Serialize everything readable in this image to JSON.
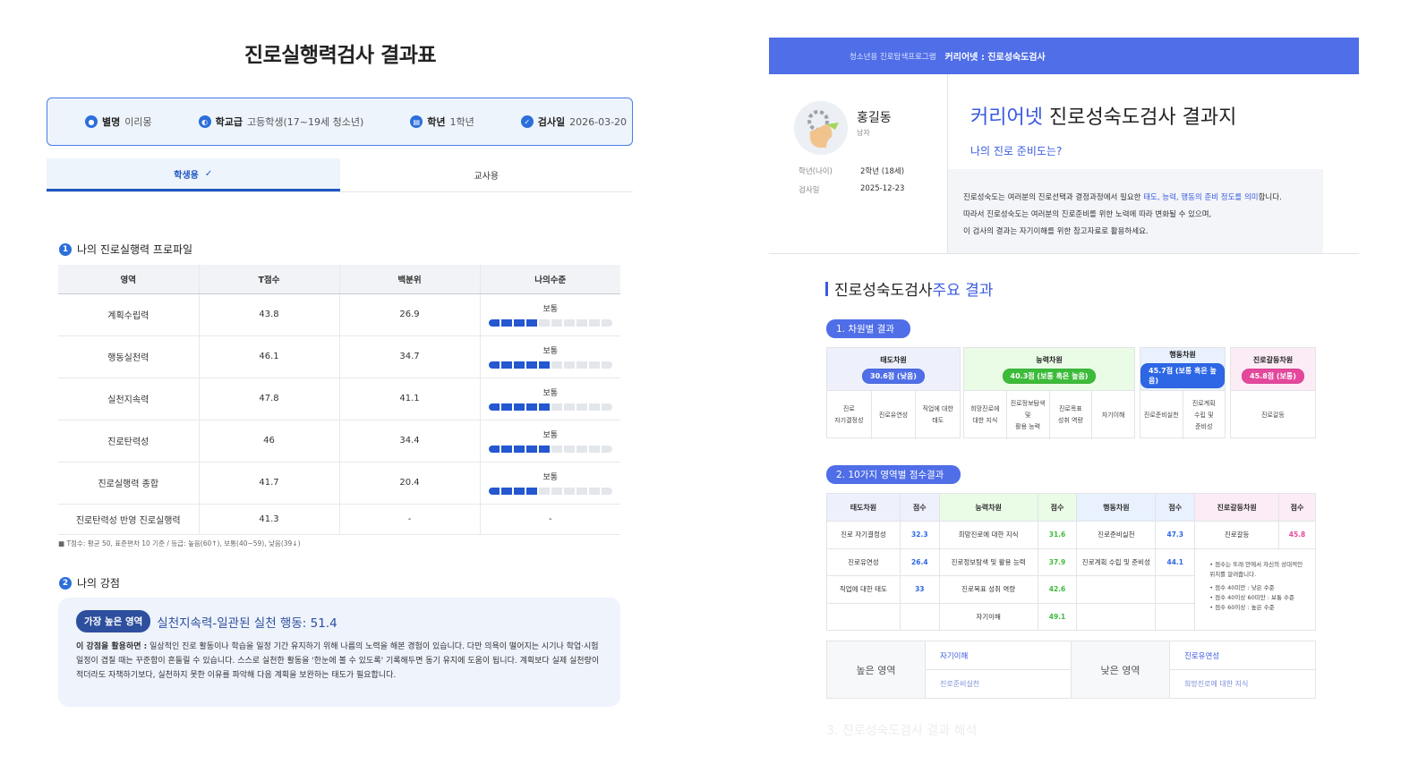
{
  "left": {
    "title": "진로실행력검사 결과표",
    "info": {
      "name_label": "별명",
      "name_value": "이리몽",
      "school_label": "학교급",
      "school_value": "고등학생(17~19세 청소년)",
      "grade_label": "학년",
      "grade_value": "1학년",
      "date_label": "검사일",
      "date_value": "2026-03-20"
    },
    "tabs": {
      "student": "학생용",
      "student_check": "✓",
      "teacher": "교사용"
    },
    "section1": {
      "num": "1",
      "title": "나의 진로실행력 프로파일"
    },
    "table": {
      "headers": [
        "영역",
        "T점수",
        "백분위",
        "나의수준"
      ],
      "rows": [
        {
          "area": "계획수립력",
          "t": "43.8",
          "pct": "26.9",
          "level": "보통",
          "filled": 4,
          "total": 10
        },
        {
          "area": "행동실천력",
          "t": "46.1",
          "pct": "34.7",
          "level": "보통",
          "filled": 5,
          "total": 10
        },
        {
          "area": "실천지속력",
          "t": "47.8",
          "pct": "41.1",
          "level": "보통",
          "filled": 5,
          "total": 10
        },
        {
          "area": "진로탄력성",
          "t": "46",
          "pct": "34.4",
          "level": "보통",
          "filled": 5,
          "total": 10
        },
        {
          "area": "진로실행력 종합",
          "t": "41.7",
          "pct": "20.4",
          "level": "보통",
          "filled": 4,
          "total": 10
        },
        {
          "area": "진로탄력성 반영 진로실행력",
          "t": "41.3",
          "pct": "-",
          "level": "-"
        }
      ]
    },
    "note": "■ T점수: 평균 50, 표준편차 10 기준 / 등급: 높음(60↑), 보통(40~59), 낮음(39↓)",
    "section2": {
      "num": "2",
      "title": "나의 강점"
    },
    "strength": {
      "badge": "가장 높은 영역",
      "title": "실천지속력-일관된 실천 행동: 51.4",
      "lead": "이 강점을 활용하면 :",
      "body": " 일상적인 진로 활동이나 학습을 일정 기간 유지하기 위해 나름의 노력을 해본 경험이 있습니다. 다만 의욕이 떨어지는 시기나 학업·시험 일정이 겹칠 때는 꾸준함이 흔들릴 수 있습니다. 스스로 실천한 활동을 '한눈에 볼 수 있도록' 기록해두면 동기 유지에 도움이 됩니다. 계획보다 실제 실천량이 적더라도 자책하기보다, 실천하지 못한 이유를 파악해 다음 계획을 보완하는 태도가 필요합니다."
    }
  },
  "right": {
    "bar": {
      "program": "청소년용 진로탐색프로그램",
      "title": "커리어넷 : 진로성숙도검사"
    },
    "profile": {
      "name": "홍길동",
      "gender": "남자",
      "grade_label": "학년(나이)",
      "grade_value": "2학년 (18세)",
      "date_label": "검사일",
      "date_value": "2025-12-23"
    },
    "title_brand": "커리어넷",
    "title_rest": " 진로성숙도검사 결과지",
    "subtitle": "나의 진로 준비도는?",
    "desc": {
      "l1a": "진로성숙도는 여러분의 진로선택과 결정과정에서 필요한 ",
      "l1b": "태도, 능력, 행동의 준비 정도를 의미",
      "l1c": "합니다.",
      "l2": "따라서 진로성숙도는 여러분의 진로준비를 위한 노력에 따라 변화될 수 있으며,",
      "l3": "이 검사의 결과는 자기이해를 위한 참고자료로 활용하세요."
    },
    "section_a": "진로성숙도검사",
    "section_b": "주요 결과",
    "pill1": "1. 차원별 결과",
    "pill2": "2. 10가지 영역별 점수결과",
    "dims": [
      {
        "name": "태도차원",
        "badge": "30.6점 (낮음)",
        "bg": "#eef1fb",
        "color": "#4f6ee7",
        "items": [
          "진로\n자기결정성",
          "진로유연성",
          "직업에 대한\n태도"
        ]
      },
      {
        "name": "능력차원",
        "badge": "40.3점 (보통 혹은 높음)",
        "bg": "#eafbe6",
        "color": "#3dbb3a",
        "items": [
          "희망진로에\n대한 지식",
          "진로정보탐색 및\n활용 능력",
          "진로목표\n성취 역량",
          "자기이해"
        ]
      },
      {
        "name": "행동차원",
        "badge": "45.7점 (보통 혹은 높음)",
        "bg": "#e8f1fd",
        "color": "#2d67e5",
        "items": [
          "진로준비실천",
          "진로계획\n수립 및\n준비성"
        ]
      },
      {
        "name": "진로갈등차원",
        "badge": "45.8점 (보통)",
        "bg": "#fcecf6",
        "color": "#e4489c",
        "items": [
          "진로갈등"
        ]
      }
    ],
    "t2": {
      "headers": [
        "태도차원",
        "점수",
        "능력차원",
        "점수",
        "행동차원",
        "점수",
        "진로갈등차원",
        "점수"
      ],
      "rows": [
        [
          "진로 자기결정성",
          "32.3",
          "희망진로에 대한 지식",
          "31.6",
          "진로준비실천",
          "47.3",
          "진로갈등",
          "45.8"
        ],
        [
          "진로유연성",
          "26.4",
          "진로정보탐색 및 활용 능력",
          "37.9",
          "진로계획 수립 및 준비성",
          "44.1"
        ],
        [
          "직업에 대한 태도",
          "33",
          "진로목표 성취 역량",
          "42.6",
          "",
          ""
        ],
        [
          "",
          "",
          "자기이해",
          "49.1",
          "",
          ""
        ]
      ],
      "note1": "• 점수는 또래 안에서 자신의 상대적인",
      "note2": "  위치를 알려줍니다.",
      "note3": "• 점수 40미만 : 낮은 수준",
      "note4": "• 점수 40이상 60미만 : 보통 수준",
      "note5": "• 점수 60이상 : 높은 수준"
    },
    "high_label": "높은 영역",
    "high_1": "자기이해",
    "high_2": "진로준비실천",
    "low_label": "낮은 영역",
    "low_1": "진로유연성",
    "low_2": "희망진로에 대한 지식",
    "fade": "3. 진로성숙도검사 결과 해석"
  },
  "colors": {
    "primary": "#2c6fdb",
    "accent": "#4f6ee7",
    "green": "#3dbb3a",
    "pink": "#e4489c"
  }
}
